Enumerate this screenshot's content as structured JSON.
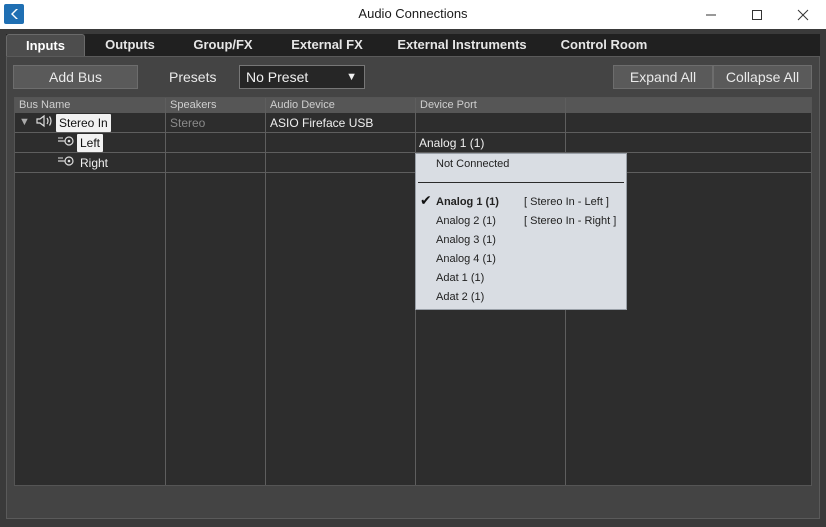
{
  "window": {
    "title": "Audio Connections"
  },
  "tabs": [
    {
      "label": "Inputs",
      "active": true
    },
    {
      "label": "Outputs"
    },
    {
      "label": "Group/FX"
    },
    {
      "label": "External FX"
    },
    {
      "label": "External Instruments"
    },
    {
      "label": "Control Room"
    }
  ],
  "toolbar": {
    "add_bus_label": "Add Bus",
    "presets_label": "Presets",
    "preset_value": "No Preset",
    "expand_all_label": "Expand All",
    "collapse_all_label": "Collapse All"
  },
  "grid": {
    "headers": [
      "Bus Name",
      "Speakers",
      "Audio Device",
      "Device Port"
    ],
    "rows": [
      {
        "bus_name": "Stereo In",
        "speakers": "Stereo",
        "audio_device": "ASIO Fireface USB",
        "device_port": ""
      },
      {
        "bus_name": "Left",
        "speakers": "",
        "audio_device": "",
        "device_port": "Analog 1 (1)"
      },
      {
        "bus_name": "Right",
        "speakers": "",
        "audio_device": "",
        "device_port": ""
      }
    ]
  },
  "dropdown": {
    "not_connected": "Not Connected",
    "items": [
      {
        "label": "Analog 1 (1)",
        "note": "[ Stereo In - Left ]",
        "checked": true
      },
      {
        "label": "Analog 2 (1)",
        "note": "[ Stereo In - Right ]"
      },
      {
        "label": "Analog 3 (1)"
      },
      {
        "label": "Analog 4 (1)"
      },
      {
        "label": "Adat 1 (1)"
      },
      {
        "label": "Adat 2 (1)"
      }
    ]
  },
  "colors": {
    "accent": "#1f6fb3",
    "panel": "#444444",
    "dropdown_bg": "#d9dde3"
  }
}
